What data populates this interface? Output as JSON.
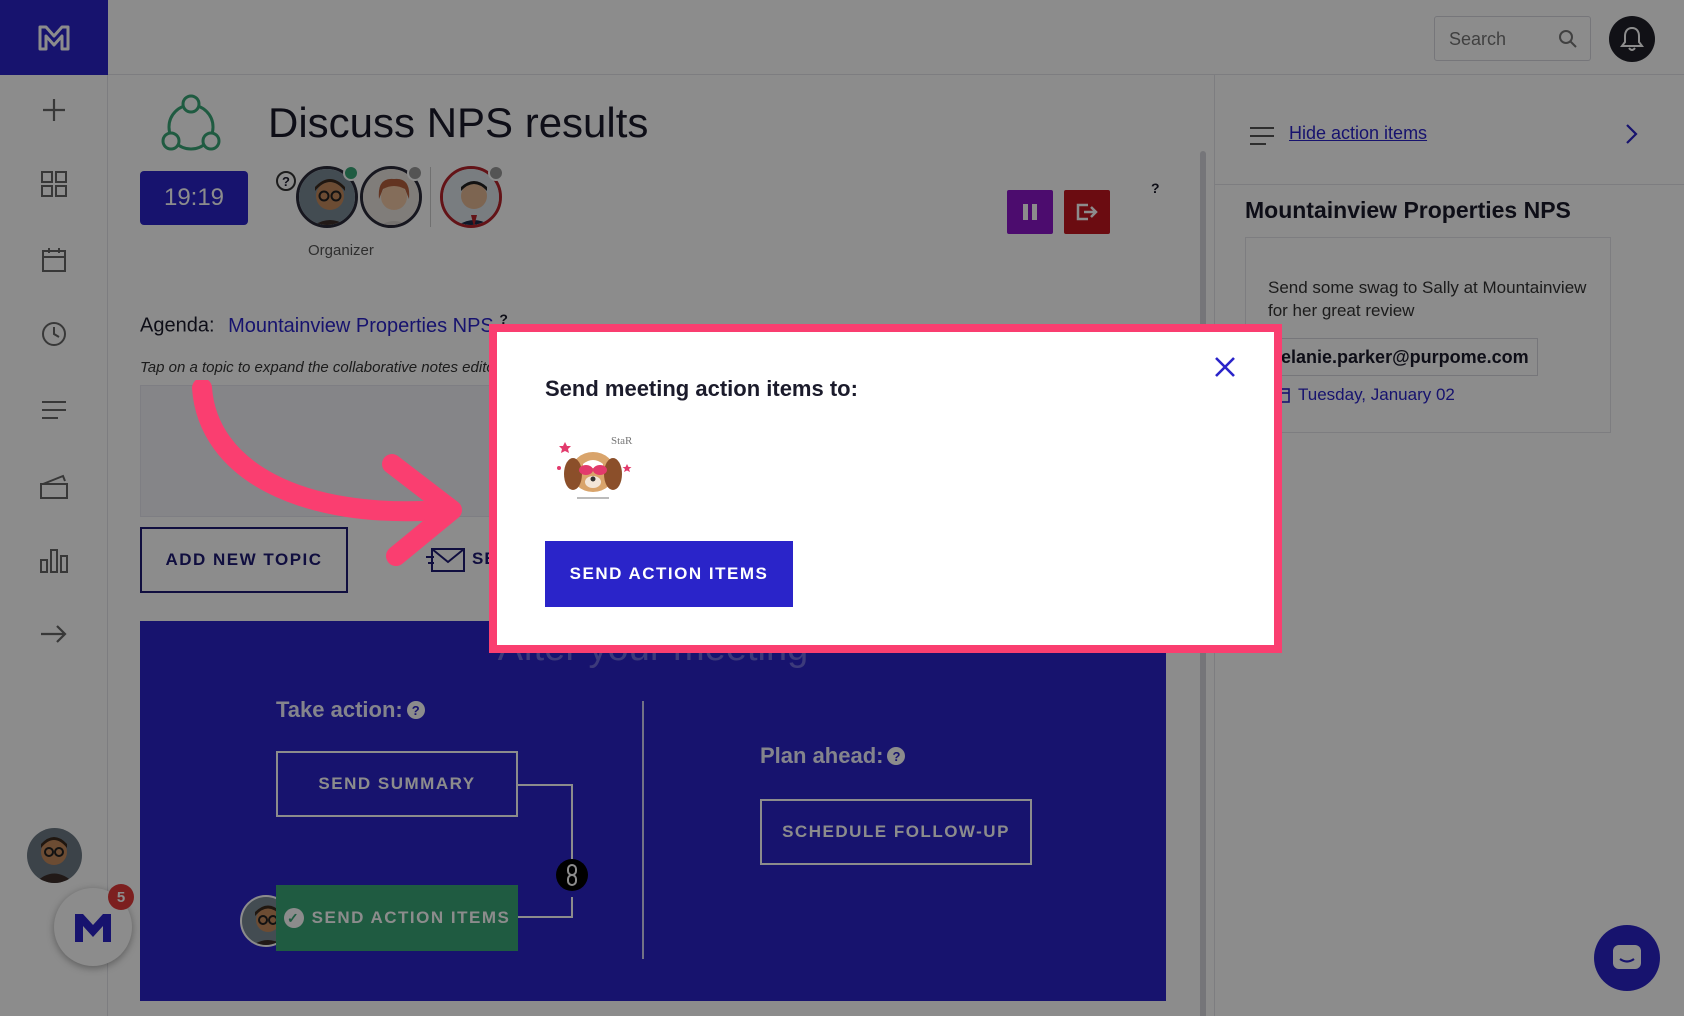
{
  "topbar": {
    "search_placeholder": "Search"
  },
  "meeting": {
    "title": "Discuss NPS results",
    "timer": "19:19",
    "organizer_label": "Organizer",
    "help_mark": "?",
    "agenda_label": "Agenda:",
    "agenda_link": "Mountainview Properties NPS",
    "agenda_help": "?",
    "hint": "Tap on a topic to expand the collaborative notes editor",
    "add_topic_label": "ADD NEW TOPIC",
    "send_partial_label": "SE"
  },
  "after_meeting": {
    "heading": "After your meeting",
    "take_action_label": "Take action:",
    "plan_ahead_label": "Plan ahead:",
    "help_mark": "?",
    "send_summary_label": "SEND SUMMARY",
    "send_action_items_label": "SEND ACTION ITEMS",
    "schedule_followup_label": "SCHEDULE FOLLOW-UP"
  },
  "right_panel": {
    "hide_link": "Hide action items",
    "title": "Mountainview Properties NPS",
    "action_item": {
      "text": "Send some swag to Sally at Mountainview for her great review",
      "assignee": "melanie.parker@purpome.com",
      "due_date": "Tuesday, January 02"
    }
  },
  "notifications": {
    "fab_badge": "5"
  },
  "modal": {
    "title": "Send meeting action items to:",
    "send_button": "SEND ACTION ITEMS",
    "recipient_avatar_text": "StaR"
  },
  "colors": {
    "brand": "#2a24c9",
    "highlight": "#fa3e70",
    "success": "#3aa777",
    "stop": "#c3171f",
    "pause": "#8b16c9"
  }
}
